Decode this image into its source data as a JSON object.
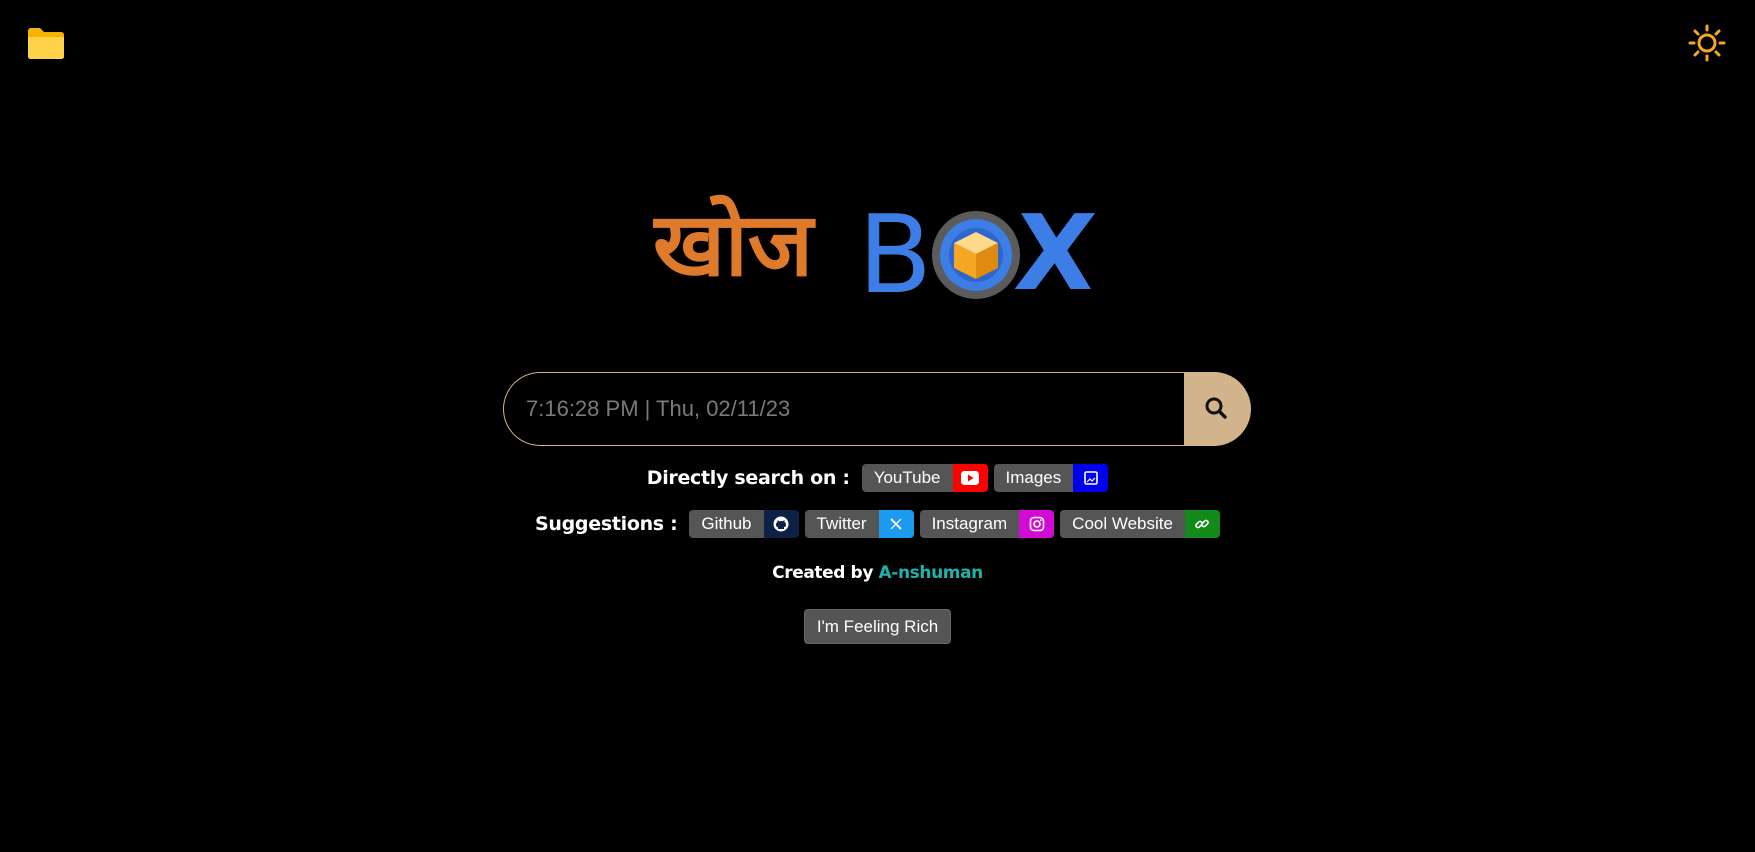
{
  "logo": {
    "hindi_text": "खोज",
    "latin_text_b": "B",
    "latin_text_x": "X",
    "hindi_color": "#e07a2b",
    "latin_color": "#3d7ee6"
  },
  "icons": {
    "folder": "folder-icon",
    "theme": "sun-icon",
    "search": "magnifier-icon"
  },
  "search": {
    "placeholder": "7:16:28 PM | Thu, 02/11/23",
    "button_color": "#d2b48c",
    "border_color": "#d2b48c"
  },
  "direct_search": {
    "label": "Directly search on :",
    "items": [
      {
        "label": "YouTube",
        "icon": "youtube-icon",
        "color": "#ff0000"
      },
      {
        "label": "Images",
        "icon": "image-icon",
        "color": "#0000ee"
      }
    ]
  },
  "suggestions": {
    "label": "Suggestions :",
    "items": [
      {
        "label": "Github",
        "icon": "github-icon",
        "color": "#0d2045"
      },
      {
        "label": "Twitter",
        "icon": "x-icon",
        "color": "#1d9bf0"
      },
      {
        "label": "Instagram",
        "icon": "instagram-icon",
        "color": "#d30ad3"
      },
      {
        "label": "Cool Website",
        "icon": "link-icon",
        "color": "#118a1a"
      }
    ]
  },
  "credit": {
    "prefix": "Created by",
    "author": "A-nshuman",
    "author_color": "#20b2aa"
  },
  "feeling_rich_button": "I'm Feeling Rich"
}
